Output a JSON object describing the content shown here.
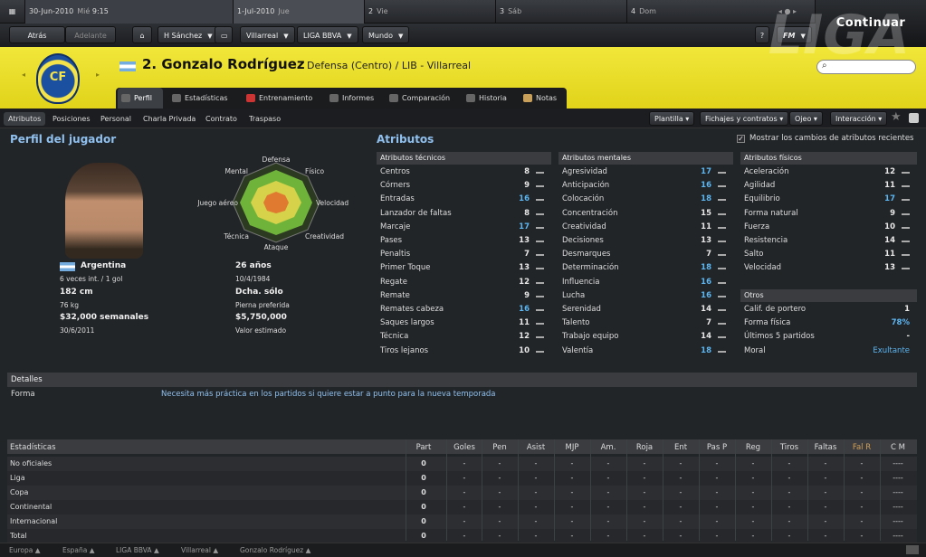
{
  "calendar": {
    "current_date": "30-Jun-2010",
    "current_day": "Mié",
    "current_time": "9:15",
    "days": [
      {
        "date": "1-Jul-2010",
        "day": "Jue"
      },
      {
        "date": "2",
        "day": "Vie"
      },
      {
        "date": "3",
        "day": "Sáb"
      },
      {
        "date": "4",
        "day": "Dom"
      }
    ]
  },
  "continue_label": "Continuar",
  "nav": {
    "back": "Atrás",
    "forward": "Adelante",
    "manager": "H Sánchez",
    "club": "Villarreal",
    "league": "LIGA BBVA",
    "world": "Mundo",
    "help": "?",
    "fm": "FM"
  },
  "player": {
    "number_name": "2. Gonzalo Rodríguez",
    "position": "Defensa (Centro) / LIB - Villarreal",
    "crest_text": "CF",
    "liga_watermark": "LIGA"
  },
  "tabs": [
    "Perfil",
    "Estadísticas",
    "Entrenamiento",
    "Informes",
    "Comparación",
    "Historia",
    "Notas"
  ],
  "subtabs": [
    "Atributos",
    "Posiciones",
    "Personal",
    "Charla Privada",
    "Contrato",
    "Traspaso"
  ],
  "actions": [
    "Plantilla",
    "Fichajes y contratos",
    "Ojeo",
    "Interacción"
  ],
  "profile": {
    "title": "Perfil del jugador",
    "nationality": "Argentina",
    "caps": "6 veces int. / 1 gol",
    "height": "182 cm",
    "weight": "76 kg",
    "wage": "$32,000 semanales",
    "contract_end": "30/6/2011",
    "age": "26 años",
    "dob": "10/4/1984",
    "foot": "Dcha. sólo",
    "foot_label": "Pierna preferida",
    "value": "$5,750,000",
    "value_label": "Valor estimado"
  },
  "radar": {
    "labels": [
      "Defensa",
      "Físico",
      "Velocidad",
      "Creatividad",
      "Ataque",
      "Técnica",
      "Juego aéreo",
      "Mental"
    ]
  },
  "attributes": {
    "title": "Atributos",
    "show_changes": "Mostrar los cambios de atributos recientes",
    "technical_title": "Atributos técnicos",
    "technical": [
      [
        "Centros",
        "8"
      ],
      [
        "Córners",
        "9"
      ],
      [
        "Entradas",
        "16"
      ],
      [
        "Lanzador de faltas",
        "8"
      ],
      [
        "Marcaje",
        "17"
      ],
      [
        "Pases",
        "13"
      ],
      [
        "Penaltis",
        "7"
      ],
      [
        "Primer Toque",
        "13"
      ],
      [
        "Regate",
        "12"
      ],
      [
        "Remate",
        "9"
      ],
      [
        "Remates cabeza",
        "16"
      ],
      [
        "Saques largos",
        "11"
      ],
      [
        "Técnica",
        "12"
      ],
      [
        "Tiros lejanos",
        "10"
      ]
    ],
    "mental_title": "Atributos mentales",
    "mental": [
      [
        "Agresividad",
        "17"
      ],
      [
        "Anticipación",
        "16"
      ],
      [
        "Colocación",
        "18"
      ],
      [
        "Concentración",
        "15"
      ],
      [
        "Creatividad",
        "11"
      ],
      [
        "Decisiones",
        "13"
      ],
      [
        "Desmarques",
        "7"
      ],
      [
        "Determinación",
        "18"
      ],
      [
        "Influencia",
        "16"
      ],
      [
        "Lucha",
        "16"
      ],
      [
        "Serenidad",
        "14"
      ],
      [
        "Talento",
        "7"
      ],
      [
        "Trabajo equipo",
        "14"
      ],
      [
        "Valentía",
        "18"
      ]
    ],
    "physical_title": "Atributos físicos",
    "physical": [
      [
        "Aceleración",
        "12"
      ],
      [
        "Agilidad",
        "11"
      ],
      [
        "Equilibrio",
        "17"
      ],
      [
        "Forma natural",
        "9"
      ],
      [
        "Fuerza",
        "10"
      ],
      [
        "Resistencia",
        "14"
      ],
      [
        "Salto",
        "11"
      ],
      [
        "Velocidad",
        "13"
      ]
    ],
    "other_title": "Otros",
    "other": [
      [
        "Calif. de portero",
        "1"
      ],
      [
        "Forma física",
        "78%"
      ],
      [
        "Últimos 5 partidos",
        "-"
      ],
      [
        "Moral",
        "Exultante"
      ]
    ]
  },
  "details": {
    "title": "Detalles",
    "form_label": "Forma",
    "form_text": "Necesita más práctica en los partidos si quiere estar a punto para la nueva temporada"
  },
  "stats": {
    "title": "Estadísticas",
    "headers": [
      "Part",
      "Goles",
      "Pen",
      "Asist",
      "MJP",
      "Am.",
      "Roja",
      "Ent",
      "Pas P",
      "Reg",
      "Tiros",
      "Faltas",
      "Fal R",
      "C M"
    ],
    "rows": [
      {
        "name": "No oficiales",
        "part": "0"
      },
      {
        "name": "Liga",
        "part": "0"
      },
      {
        "name": "Copa",
        "part": "0"
      },
      {
        "name": "Continental",
        "part": "0"
      },
      {
        "name": "Internacional",
        "part": "0"
      },
      {
        "name": "Total",
        "part": "0"
      }
    ],
    "dash": "-",
    "dash4": "----"
  },
  "breadcrumb": [
    "Europa",
    "España",
    "LIGA BBVA",
    "Villarreal",
    "Gonzalo Rodríguez"
  ]
}
